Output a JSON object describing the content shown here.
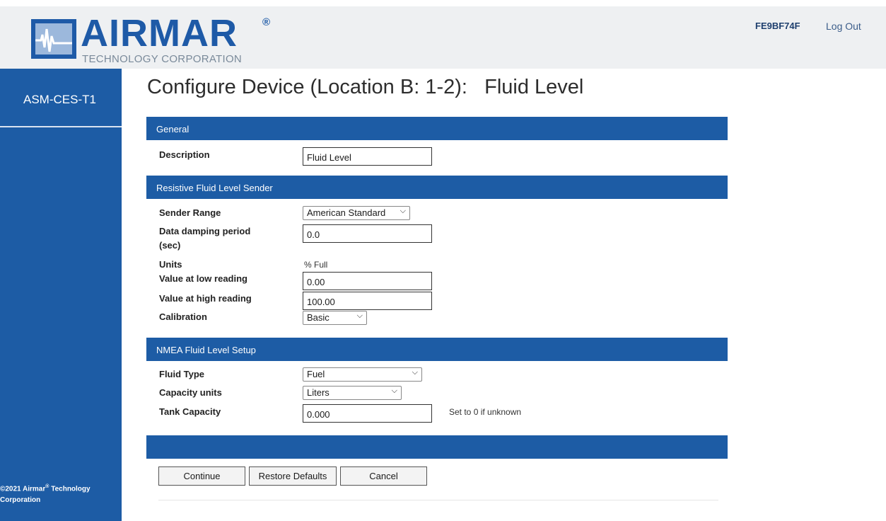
{
  "header": {
    "logo_word": "AIRMAR",
    "logo_reg": "®",
    "logo_sub": "TECHNOLOGY CORPORATION",
    "device_id": "FE9BF74F",
    "logout_label": "Log Out"
  },
  "sidebar": {
    "title": "ASM-CES-T1",
    "copyright_prefix": "©2021 Airmar",
    "copyright_sup": "®",
    "copyright_suffix": " Technology Corporation"
  },
  "page": {
    "title": "Configure Device (Location B: 1-2):   Fluid Level"
  },
  "general": {
    "section_label": "General",
    "description_label": "Description",
    "description_value": "Fluid Level"
  },
  "sender": {
    "section_label": "Resistive Fluid Level Sender",
    "range_label": "Sender Range",
    "range_value": "American Standard",
    "damping_label_1": "Data damping period",
    "damping_label_2": "(sec)",
    "damping_value": "0.0",
    "units_label": "Units",
    "units_value": "% Full",
    "low_label": "Value at low reading",
    "low_value": "0.00",
    "high_label": "Value at high reading",
    "high_value": "100.00",
    "calibration_label": "Calibration",
    "calibration_value": "Basic"
  },
  "nmea": {
    "section_label": "NMEA Fluid Level Setup",
    "fluid_type_label": "Fluid Type",
    "fluid_type_value": "Fuel",
    "capacity_units_label": "Capacity units",
    "capacity_units_value": "Liters",
    "tank_capacity_label": "Tank Capacity",
    "tank_capacity_value": "0.000",
    "tank_capacity_hint": "Set to 0 if unknown"
  },
  "buttons": {
    "continue_label": "Continue",
    "restore_label": "Restore Defaults",
    "cancel_label": "Cancel"
  },
  "icons": {
    "dropdown": "chevron-down-icon"
  },
  "colors": {
    "brand_blue": "#1d5ca5",
    "header_bg": "#eef0f2"
  }
}
